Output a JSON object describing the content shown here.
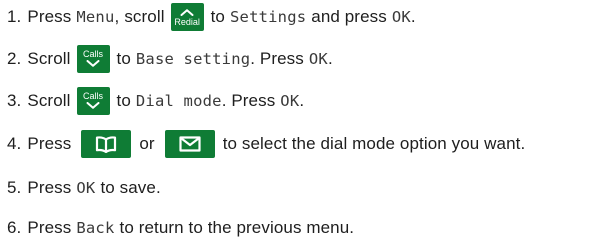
{
  "steps": [
    {
      "number": "1.",
      "press": "Press",
      "menu": "Menu",
      "scroll": "scroll",
      "key": "Redial",
      "to": "to",
      "target": "Settings",
      "and": "and press",
      "ok": "OK",
      "end": "."
    },
    {
      "number": "2.",
      "scroll": "Scroll",
      "key": "Calls",
      "to": "to",
      "target": "Base setting",
      "press": ". Press",
      "ok": "OK",
      "end": "."
    },
    {
      "number": "3.",
      "scroll": "Scroll",
      "key": "Calls",
      "to": "to",
      "target": "Dial mode",
      "press": ". Press",
      "ok": "OK",
      "end": "."
    },
    {
      "number": "4.",
      "press": "Press",
      "key1": "phonebook-icon",
      "or": "or",
      "key2": "envelope-icon",
      "rest": "to select the dial mode option you want."
    },
    {
      "number": "5.",
      "press": "Press",
      "ok": "OK",
      "rest": "to save."
    },
    {
      "number": "6.",
      "press": "Press",
      "back": "Back",
      "rest": "to return to the previous menu."
    }
  ],
  "colors": {
    "key_background": "#0f7c35",
    "key_foreground": "#ffffff",
    "text": "#1e1e1e"
  }
}
